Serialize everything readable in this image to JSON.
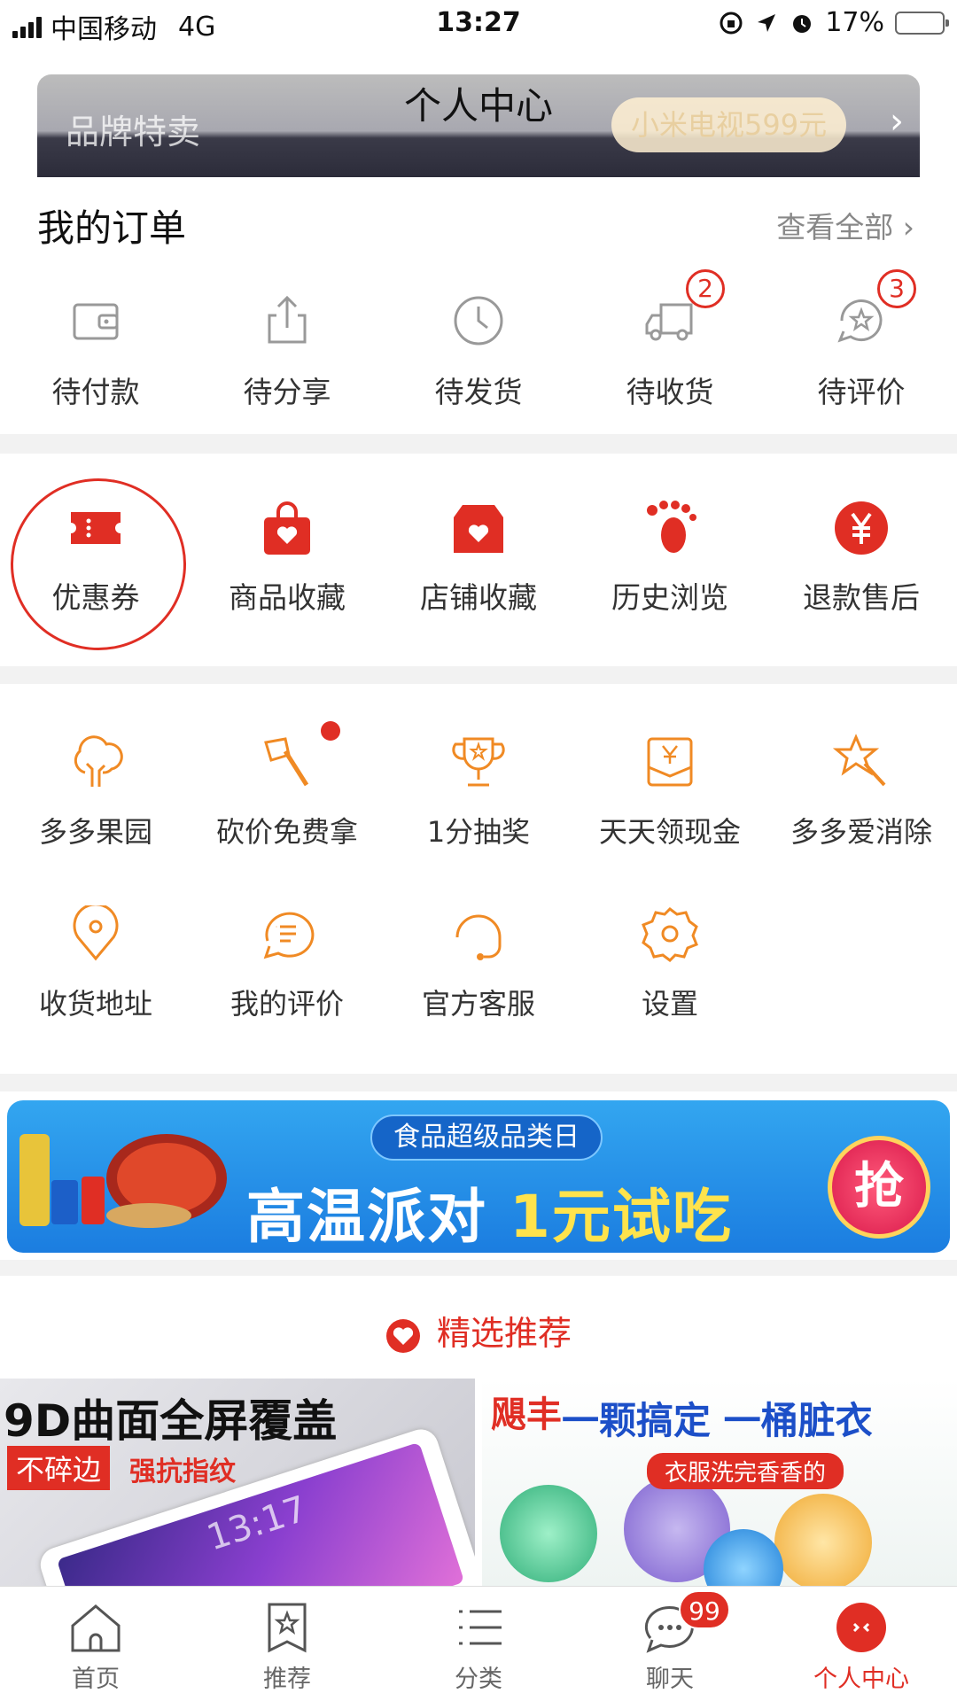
{
  "status": {
    "carrier": "中国移动",
    "network": "4G",
    "time": "13:27",
    "battery": "17%"
  },
  "header": {
    "title": "个人中心",
    "brand": "品牌特卖",
    "promo": "小米电视599元"
  },
  "orders": {
    "title": "我的订单",
    "view_all": "查看全部",
    "items": [
      {
        "label": "待付款",
        "icon": "wallet-icon"
      },
      {
        "label": "待分享",
        "icon": "share-icon"
      },
      {
        "label": "待发货",
        "icon": "clock-icon"
      },
      {
        "label": "待收货",
        "icon": "truck-icon",
        "badge": "2"
      },
      {
        "label": "待评价",
        "icon": "review-icon",
        "badge": "3"
      }
    ]
  },
  "functions": [
    {
      "label": "优惠券",
      "icon": "coupon-icon"
    },
    {
      "label": "商品收藏",
      "icon": "bag-heart-icon"
    },
    {
      "label": "店铺收藏",
      "icon": "shop-heart-icon"
    },
    {
      "label": "历史浏览",
      "icon": "footprint-icon"
    },
    {
      "label": "退款售后",
      "icon": "yuan-icon"
    }
  ],
  "tools": [
    {
      "label": "多多果园",
      "icon": "tree-icon"
    },
    {
      "label": "砍价免费拿",
      "icon": "axe-icon"
    },
    {
      "label": "1分抽奖",
      "icon": "trophy-icon"
    },
    {
      "label": "天天领现金",
      "icon": "cash-envelope-icon"
    },
    {
      "label": "多多爱消除",
      "icon": "star-wand-icon"
    },
    {
      "label": "收货地址",
      "icon": "location-icon"
    },
    {
      "label": "我的评价",
      "icon": "comment-icon"
    },
    {
      "label": "官方客服",
      "icon": "headset-icon"
    },
    {
      "label": "设置",
      "icon": "gear-icon"
    }
  ],
  "banner": {
    "pill": "食品超级品类日",
    "main_a": "高温派对 ",
    "main_b": "1元试吃",
    "action": "抢"
  },
  "recommend": {
    "title": "精选推荐"
  },
  "products": [
    {
      "headline": "9D曲面全屏覆盖",
      "tag": "不碎边",
      "tag2": "强抗指纹",
      "screen_time": "13:17"
    },
    {
      "brand": "飓丰",
      "headline": "一颗搞定 一桶脏衣",
      "sub": "衣服洗完香香的"
    }
  ],
  "tabbar": [
    {
      "label": "首页",
      "icon": "home-icon"
    },
    {
      "label": "推荐",
      "icon": "star-bookmark-icon"
    },
    {
      "label": "分类",
      "icon": "list-icon"
    },
    {
      "label": "聊天",
      "icon": "chat-icon",
      "count": "99"
    },
    {
      "label": "个人中心",
      "icon": "profile-icon",
      "active": true
    }
  ],
  "colors": {
    "accent": "#e02e24",
    "tool_orange": "#f08a24"
  }
}
